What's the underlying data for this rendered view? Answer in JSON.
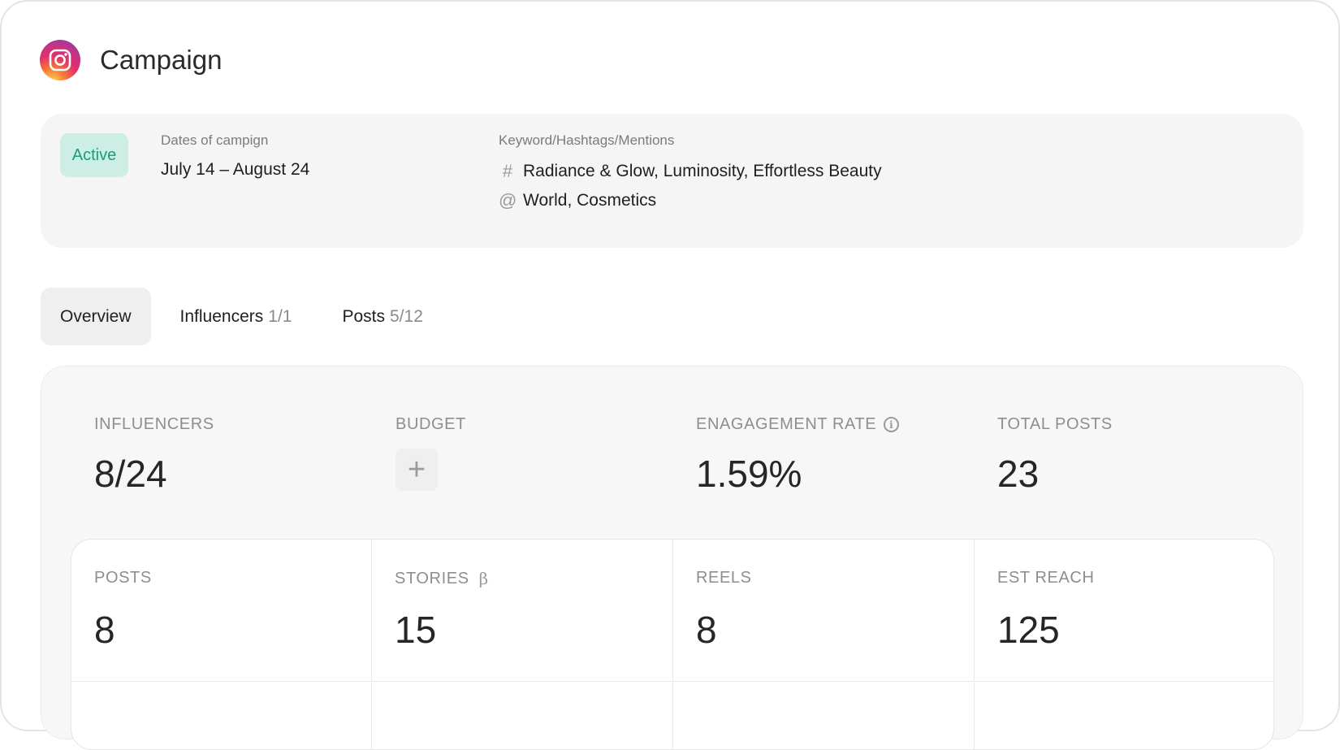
{
  "header": {
    "title": "Campaign",
    "logo_icon": "instagram-icon"
  },
  "campaign": {
    "status": "Active",
    "dates_label": "Dates of campign",
    "dates_value": "July 14 – August 24",
    "keywords_label": "Keyword/Hashtags/Mentions",
    "hashtags_symbol": "#",
    "hashtags": "Radiance & Glow, Luminosity, Effortless Beauty",
    "mentions_symbol": "@",
    "mentions": "World, Cosmetics"
  },
  "tabs": [
    {
      "label": "Overview",
      "count": ""
    },
    {
      "label": "Influencers",
      "count": "1/1"
    },
    {
      "label": "Posts",
      "count": "5/12"
    }
  ],
  "stats": {
    "influencers": {
      "label": "INFLUENCERS",
      "value": "8/24"
    },
    "budget": {
      "label": "BUDGET",
      "add": "+"
    },
    "engagement": {
      "label": "ENAGAGEMENT RATE",
      "value": "1.59%",
      "info": "i"
    },
    "total_posts": {
      "label": "TOTAL POSTS",
      "value": "23"
    }
  },
  "breakdown": {
    "posts": {
      "label": "POSTS",
      "value": "8"
    },
    "stories": {
      "label": "STORIES",
      "badge": "β",
      "value": "15"
    },
    "reels": {
      "label": "REELS",
      "value": "8"
    },
    "reach": {
      "label": "EST REACH",
      "value": "125"
    }
  },
  "colors": {
    "active_badge_bg": "#cdeee4",
    "active_badge_text": "#1e9c75"
  }
}
